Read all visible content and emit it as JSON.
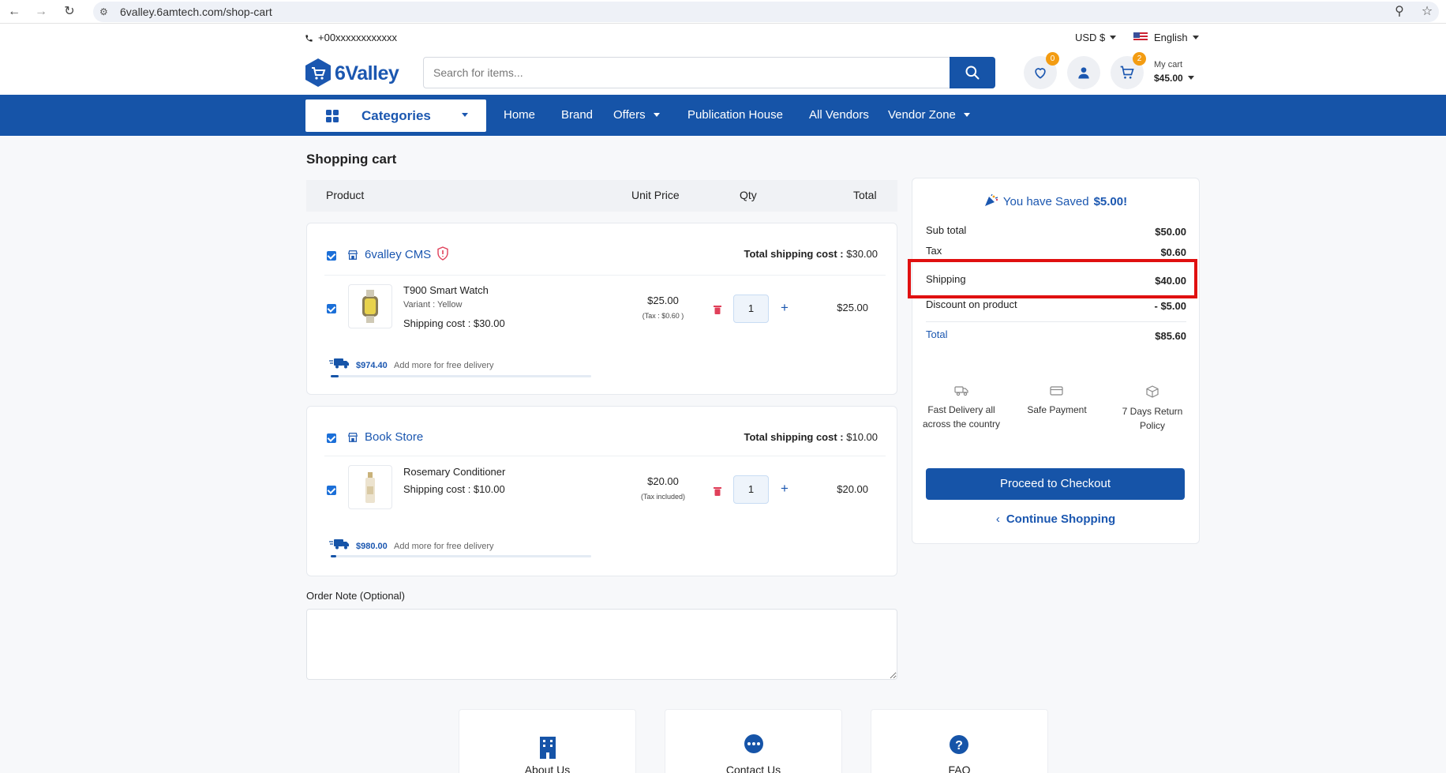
{
  "browser": {
    "url": "6valley.6amtech.com/shop-cart"
  },
  "topbar": {
    "phone": "+00xxxxxxxxxxxx",
    "currency": "USD $",
    "language": "English"
  },
  "header": {
    "logo": "6Valley",
    "search_placeholder": "Search for items...",
    "wishlist_count": "0",
    "cart_count": "2",
    "my_cart_label": "My cart",
    "cart_total": "$45.00"
  },
  "nav": {
    "categories": "Categories",
    "items": [
      "Home",
      "Brand",
      "Offers",
      "Publication House",
      "All Vendors",
      "Vendor Zone"
    ]
  },
  "cart": {
    "title": "Shopping cart",
    "columns": {
      "product": "Product",
      "unit_price": "Unit Price",
      "qty": "Qty",
      "total": "Total"
    },
    "shops": [
      {
        "name": "6valley CMS",
        "shipping_label": "Total shipping cost :",
        "shipping_value": "$30.00",
        "product": {
          "name": "T900 Smart Watch",
          "variant": "Variant : Yellow",
          "shipping_label": "Shipping cost",
          "shipping_value": ":  $30.00",
          "price": "$25.00",
          "tax": "(Tax : $0.60 )",
          "qty": "1",
          "total": "$25.00"
        },
        "free_amount": "$974.40",
        "free_text": "Add more for free delivery",
        "free_progress": 0.03
      },
      {
        "name": "Book Store",
        "shipping_label": "Total shipping cost :",
        "shipping_value": "$10.00",
        "product": {
          "name": "Rosemary Conditioner",
          "shipping_label": "Shipping cost",
          "shipping_value": ":  $10.00",
          "price": "$20.00",
          "tax": "(Tax included)",
          "qty": "1",
          "total": "$20.00"
        },
        "free_amount": "$980.00",
        "free_text": "Add more for free delivery",
        "free_progress": 0.02
      }
    ],
    "order_note_label": "Order Note (Optional)"
  },
  "summary": {
    "saved_text": "You have Saved",
    "saved_amount": "$5.00!",
    "rows": [
      {
        "label": "Sub total",
        "value": "$50.00"
      },
      {
        "label": "Tax",
        "value": "$0.60"
      },
      {
        "label": "Shipping",
        "value": "$40.00"
      },
      {
        "label": "Discount on product",
        "value": "- $5.00"
      }
    ],
    "total_label": "Total",
    "total_value": "$85.60",
    "features": [
      {
        "icon": "truck-icon",
        "text": "Fast Delivery all across the country"
      },
      {
        "icon": "card-icon",
        "text": "Safe Payment"
      },
      {
        "icon": "box-return-icon",
        "text": "7 Days Return Policy"
      }
    ],
    "checkout": "Proceed to Checkout",
    "continue": "Continue Shopping"
  },
  "footer_links": [
    "About Us",
    "Contact Us",
    "FAQ"
  ],
  "colors": {
    "brand": "#1654a8",
    "accent": "#f39c12",
    "highlight": "#e01010"
  }
}
